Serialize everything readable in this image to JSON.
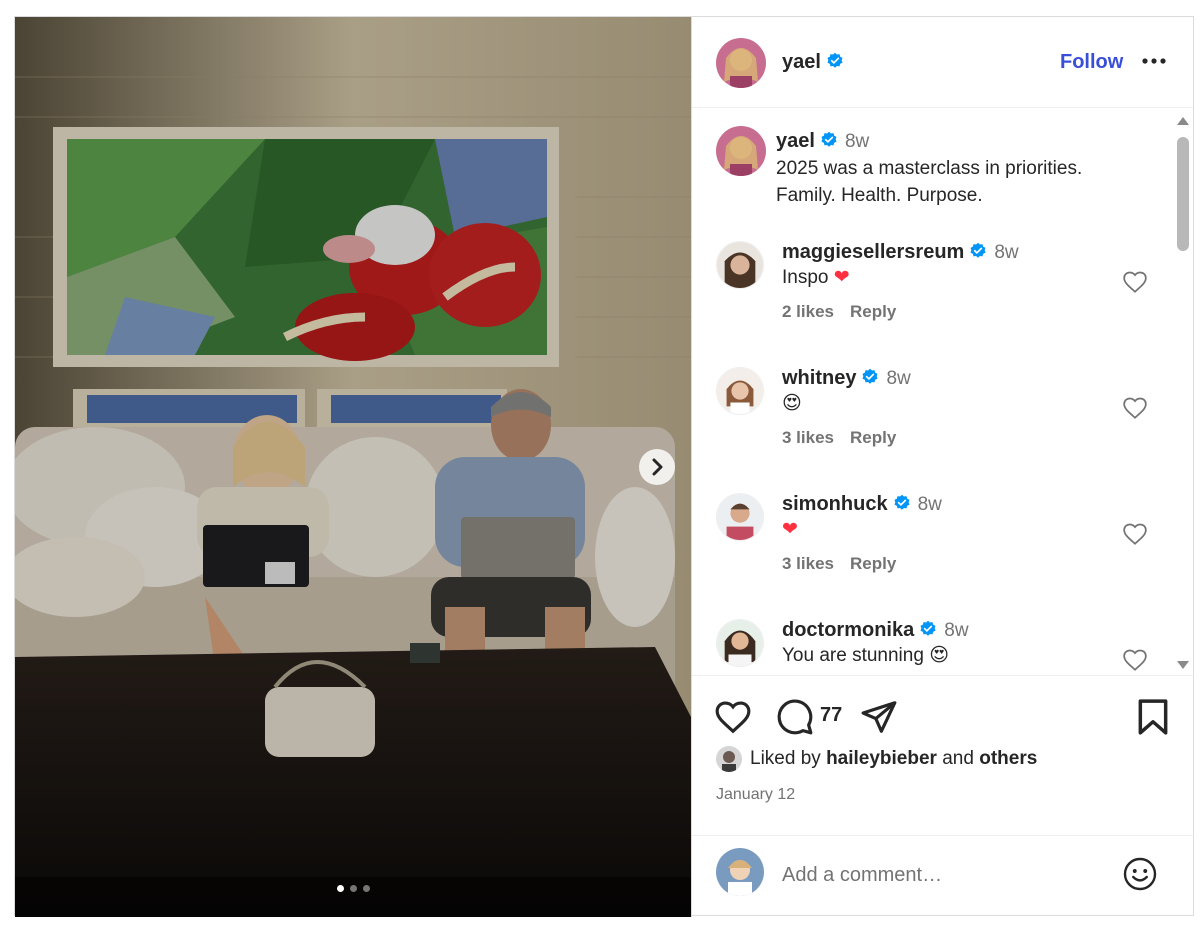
{
  "post": {
    "author": {
      "username": "yael",
      "verified": true
    },
    "follow_label": "Follow",
    "carousel": {
      "slide_count": 3,
      "active_index": 0
    }
  },
  "caption": {
    "username": "yael",
    "time": "8w",
    "lines": [
      "2025 was a masterclass in priorities.",
      "Family. Health. Purpose."
    ]
  },
  "comments": [
    {
      "username": "maggiesellersreum",
      "time": "8w",
      "text": "Inspo",
      "emoji": "❤",
      "likes": "2 likes",
      "reply": "Reply"
    },
    {
      "username": "whitney",
      "time": "8w",
      "text": "",
      "emoji": "😍",
      "likes": "3 likes",
      "reply": "Reply"
    },
    {
      "username": "simonhuck",
      "time": "8w",
      "text": "",
      "emoji": "❤",
      "likes": "3 likes",
      "reply": "Reply"
    },
    {
      "username": "doctormonika",
      "time": "8w",
      "text": "You are stunning",
      "emoji": "😍",
      "likes": "",
      "reply": ""
    }
  ],
  "actions": {
    "comment_count": "77"
  },
  "liked_by": {
    "prefix": "Liked by",
    "user": "haileybieber",
    "and": "and",
    "others": "others"
  },
  "date": "January 12",
  "add_comment": {
    "placeholder": "Add a comment…"
  },
  "colors": {
    "follow": "#3a4fd8",
    "verified": "#0095f6",
    "heart": "#ff3040",
    "muted": "#737373"
  }
}
